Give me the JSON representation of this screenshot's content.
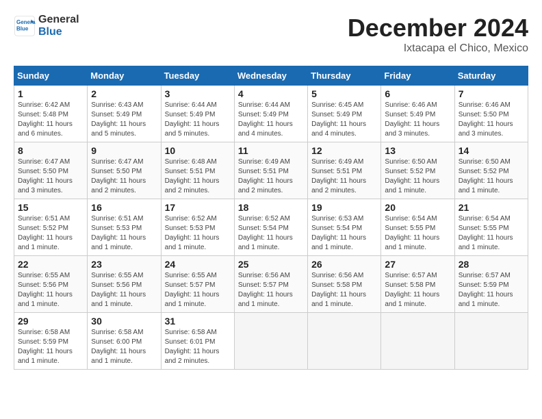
{
  "logo": {
    "line1": "General",
    "line2": "Blue"
  },
  "title": "December 2024",
  "location": "Ixtacapa el Chico, Mexico",
  "days_of_week": [
    "Sunday",
    "Monday",
    "Tuesday",
    "Wednesday",
    "Thursday",
    "Friday",
    "Saturday"
  ],
  "weeks": [
    [
      {
        "date": "1",
        "sunrise": "6:42 AM",
        "sunset": "5:48 PM",
        "daylight": "11 hours and 6 minutes."
      },
      {
        "date": "2",
        "sunrise": "6:43 AM",
        "sunset": "5:49 PM",
        "daylight": "11 hours and 5 minutes."
      },
      {
        "date": "3",
        "sunrise": "6:44 AM",
        "sunset": "5:49 PM",
        "daylight": "11 hours and 5 minutes."
      },
      {
        "date": "4",
        "sunrise": "6:44 AM",
        "sunset": "5:49 PM",
        "daylight": "11 hours and 4 minutes."
      },
      {
        "date": "5",
        "sunrise": "6:45 AM",
        "sunset": "5:49 PM",
        "daylight": "11 hours and 4 minutes."
      },
      {
        "date": "6",
        "sunrise": "6:46 AM",
        "sunset": "5:49 PM",
        "daylight": "11 hours and 3 minutes."
      },
      {
        "date": "7",
        "sunrise": "6:46 AM",
        "sunset": "5:50 PM",
        "daylight": "11 hours and 3 minutes."
      }
    ],
    [
      {
        "date": "8",
        "sunrise": "6:47 AM",
        "sunset": "5:50 PM",
        "daylight": "11 hours and 3 minutes."
      },
      {
        "date": "9",
        "sunrise": "6:47 AM",
        "sunset": "5:50 PM",
        "daylight": "11 hours and 2 minutes."
      },
      {
        "date": "10",
        "sunrise": "6:48 AM",
        "sunset": "5:51 PM",
        "daylight": "11 hours and 2 minutes."
      },
      {
        "date": "11",
        "sunrise": "6:49 AM",
        "sunset": "5:51 PM",
        "daylight": "11 hours and 2 minutes."
      },
      {
        "date": "12",
        "sunrise": "6:49 AM",
        "sunset": "5:51 PM",
        "daylight": "11 hours and 2 minutes."
      },
      {
        "date": "13",
        "sunrise": "6:50 AM",
        "sunset": "5:52 PM",
        "daylight": "11 hours and 1 minute."
      },
      {
        "date": "14",
        "sunrise": "6:50 AM",
        "sunset": "5:52 PM",
        "daylight": "11 hours and 1 minute."
      }
    ],
    [
      {
        "date": "15",
        "sunrise": "6:51 AM",
        "sunset": "5:52 PM",
        "daylight": "11 hours and 1 minute."
      },
      {
        "date": "16",
        "sunrise": "6:51 AM",
        "sunset": "5:53 PM",
        "daylight": "11 hours and 1 minute."
      },
      {
        "date": "17",
        "sunrise": "6:52 AM",
        "sunset": "5:53 PM",
        "daylight": "11 hours and 1 minute."
      },
      {
        "date": "18",
        "sunrise": "6:52 AM",
        "sunset": "5:54 PM",
        "daylight": "11 hours and 1 minute."
      },
      {
        "date": "19",
        "sunrise": "6:53 AM",
        "sunset": "5:54 PM",
        "daylight": "11 hours and 1 minute."
      },
      {
        "date": "20",
        "sunrise": "6:54 AM",
        "sunset": "5:55 PM",
        "daylight": "11 hours and 1 minute."
      },
      {
        "date": "21",
        "sunrise": "6:54 AM",
        "sunset": "5:55 PM",
        "daylight": "11 hours and 1 minute."
      }
    ],
    [
      {
        "date": "22",
        "sunrise": "6:55 AM",
        "sunset": "5:56 PM",
        "daylight": "11 hours and 1 minute."
      },
      {
        "date": "23",
        "sunrise": "6:55 AM",
        "sunset": "5:56 PM",
        "daylight": "11 hours and 1 minute."
      },
      {
        "date": "24",
        "sunrise": "6:55 AM",
        "sunset": "5:57 PM",
        "daylight": "11 hours and 1 minute."
      },
      {
        "date": "25",
        "sunrise": "6:56 AM",
        "sunset": "5:57 PM",
        "daylight": "11 hours and 1 minute."
      },
      {
        "date": "26",
        "sunrise": "6:56 AM",
        "sunset": "5:58 PM",
        "daylight": "11 hours and 1 minute."
      },
      {
        "date": "27",
        "sunrise": "6:57 AM",
        "sunset": "5:58 PM",
        "daylight": "11 hours and 1 minute."
      },
      {
        "date": "28",
        "sunrise": "6:57 AM",
        "sunset": "5:59 PM",
        "daylight": "11 hours and 1 minute."
      }
    ],
    [
      {
        "date": "29",
        "sunrise": "6:58 AM",
        "sunset": "5:59 PM",
        "daylight": "11 hours and 1 minute."
      },
      {
        "date": "30",
        "sunrise": "6:58 AM",
        "sunset": "6:00 PM",
        "daylight": "11 hours and 1 minute."
      },
      {
        "date": "31",
        "sunrise": "6:58 AM",
        "sunset": "6:01 PM",
        "daylight": "11 hours and 2 minutes."
      },
      null,
      null,
      null,
      null
    ]
  ],
  "labels": {
    "sunrise": "Sunrise:",
    "sunset": "Sunset:",
    "daylight": "Daylight:"
  },
  "colors": {
    "header_bg": "#1a6ab1"
  }
}
